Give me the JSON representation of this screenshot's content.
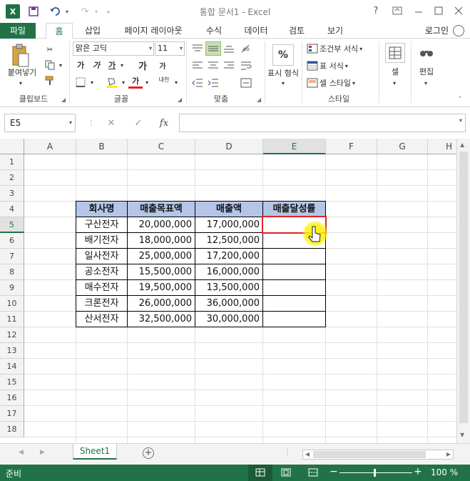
{
  "window": {
    "title": "통합 문서1 - Excel",
    "help": "?",
    "logo": "X"
  },
  "tabs": [
    {
      "label": "파일",
      "kind": "file"
    },
    {
      "label": "홈",
      "kind": "active"
    },
    {
      "label": "삽입"
    },
    {
      "label": "페이지 레이아웃"
    },
    {
      "label": "수식"
    },
    {
      "label": "데이터"
    },
    {
      "label": "검토"
    },
    {
      "label": "보기"
    }
  ],
  "account": {
    "login_label": "로그인"
  },
  "ribbon": {
    "clipboard": {
      "paste_label": "붙여넣기",
      "group_label": "클립보드"
    },
    "font": {
      "font_name": "맑은 고딕",
      "font_size": "11",
      "group_label": "글꼴",
      "bold": "가",
      "italic": "가",
      "underline": "가",
      "grow": "가",
      "shrink": "가",
      "font_color": "가",
      "phonetic": "내천"
    },
    "alignment": {
      "group_label": "맞춤"
    },
    "number": {
      "percent": "%",
      "format_label": "표시 형식"
    },
    "styles": {
      "conditional": "조건부 서식",
      "table": "표 서식",
      "cell_style": "셀 스타일",
      "group_label": "스타일"
    },
    "cells": {
      "label": "셀"
    },
    "editing": {
      "label": "편집"
    }
  },
  "formula_bar": {
    "name_box": "E5",
    "fx": "fx",
    "value": ""
  },
  "columns": [
    "A",
    "B",
    "C",
    "D",
    "E",
    "F",
    "G",
    "H"
  ],
  "rows": [
    "1",
    "2",
    "3",
    "4",
    "5",
    "6",
    "7",
    "8",
    "9",
    "10",
    "11",
    "12",
    "13",
    "14",
    "15",
    "16",
    "17",
    "18"
  ],
  "table": {
    "headers": [
      "회사명",
      "매출목표액",
      "매출액",
      "매출달성률"
    ],
    "rows": [
      [
        "구산전자",
        "20,000,000",
        "17,000,000",
        ""
      ],
      [
        "배기전자",
        "18,000,000",
        "12,500,000",
        ""
      ],
      [
        "일사전자",
        "25,000,000",
        "17,200,000",
        ""
      ],
      [
        "공소전자",
        "15,500,000",
        "16,000,000",
        ""
      ],
      [
        "매수전자",
        "19,500,000",
        "13,500,000",
        ""
      ],
      [
        "크론전자",
        "26,000,000",
        "36,000,000",
        ""
      ],
      [
        "산서전자",
        "32,500,000",
        "30,000,000",
        ""
      ]
    ]
  },
  "selection": {
    "cell": "E5"
  },
  "sheets": [
    {
      "name": "Sheet1",
      "active": true
    }
  ],
  "status": {
    "ready": "준비",
    "zoom": "100 %"
  },
  "colors": {
    "accent": "#217346",
    "header_fill": "#b4c6e7",
    "selection_border": "#e02424"
  }
}
